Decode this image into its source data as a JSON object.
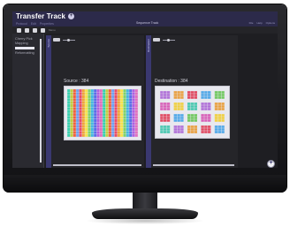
{
  "app": {
    "title": "Transfer Track",
    "add_symbol": "+"
  },
  "menu": [
    "Protocol",
    "Edit",
    "Properties"
  ],
  "status_center": "Sequence Track",
  "window_controls": [
    "File",
    "Help",
    "Options"
  ],
  "toolbar": {
    "icons": [
      "new-icon",
      "open-icon",
      "save-icon",
      "export-icon"
    ],
    "label": "Menu"
  },
  "sidebar": {
    "items": [
      "Cherry Pick",
      "Mapping",
      "Reformatting"
    ]
  },
  "panels": {
    "source": {
      "strip_label": "Source",
      "label": "Source : 384"
    },
    "destination": {
      "strip_label": "Destination",
      "label": "Destination : 384"
    }
  },
  "colors": {
    "titlebar": "#2c2a4a",
    "accent_strip": "#3a3870",
    "panel_bg": "#252529"
  },
  "plates": {
    "source_grid": {
      "rows": 16,
      "cols": 24
    },
    "destination_grid": {
      "rows": 4,
      "cols": 5,
      "subwells": 4
    }
  }
}
